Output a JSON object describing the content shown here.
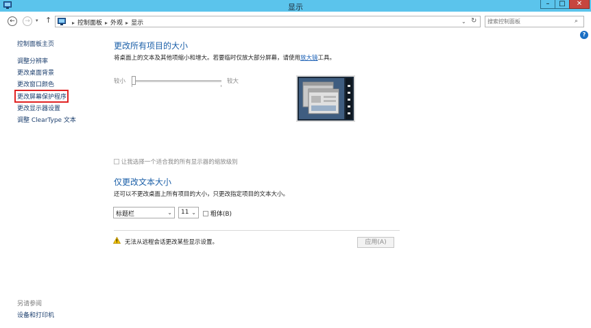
{
  "window": {
    "title": "显示",
    "min": "–",
    "max": "□",
    "close": "✕"
  },
  "icons": {
    "app": "control-panel-icon",
    "back": "back-arrow-icon",
    "forward": "forward-arrow-icon",
    "up": "up-arrow-icon",
    "search": "search-icon",
    "help": "help-icon",
    "warning": "warning-icon"
  },
  "nav": {
    "back": "←",
    "forward": "→",
    "dropdown": "▾",
    "up": "↑"
  },
  "address": {
    "crumbs": [
      "控制面板",
      "外观",
      "显示"
    ],
    "sep": "▸",
    "dropdown": "⌄",
    "refresh": "↻"
  },
  "search": {
    "placeholder": "搜索控制面板",
    "glyph": "⌕"
  },
  "help_glyph": "?",
  "sidebar": {
    "home": "控制面板主页",
    "links": [
      "调整分辨率",
      "更改桌面背景",
      "更改窗口颜色",
      "更改屏幕保护程序",
      "更改显示器设置",
      "调整 ClearType 文本"
    ],
    "see_also": "另请参阅",
    "see_also_links": [
      "设备和打印机"
    ]
  },
  "main": {
    "heading1": "更改所有项目的大小",
    "desc1_before": "将桌面上的文本及其他项缩小和增大。若要临时仅放大部分屏幕，请使用",
    "desc1_link": "放大镜",
    "desc1_after": "工具。",
    "slider": {
      "min_label": "较小",
      "max_label": "较大",
      "value": 0
    },
    "checkbox_all": "让我选择一个适合我的所有显示器的缩放级别",
    "heading2": "仅更改文本大小",
    "desc2": "还可以不更改桌面上所有项目的大小，只更改指定项目的文本大小。",
    "item_select": "标题栏",
    "size_select": "11",
    "bold_label": "粗体(B)",
    "warning": "无法从远程会话更改某些显示设置。",
    "apply": "应用(A)"
  },
  "colors": {
    "titlebar": "#5bc4ec",
    "link": "#1c3f6e",
    "heading": "#1b5fa8",
    "highlight": "#e02020",
    "close": "#c7463f"
  }
}
